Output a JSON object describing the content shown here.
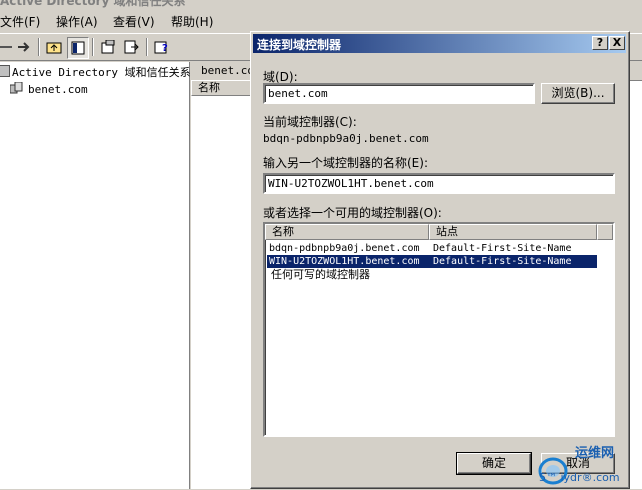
{
  "window": {
    "title": "Active Directory 域和信任关系"
  },
  "menu": [
    {
      "label": "文件(F)"
    },
    {
      "label": "操作(A)"
    },
    {
      "label": "查看(V)"
    },
    {
      "label": "帮助(H)"
    }
  ],
  "toolbar": {
    "icons": [
      "back-arrow-icon",
      "forward-arrow-icon",
      "up-folder-icon",
      "show-tree-icon",
      "properties-icon",
      "export-list-icon",
      "help-icon"
    ]
  },
  "tree": {
    "root": "Active Directory 域和信任关系",
    "child": "benet.com"
  },
  "right_pane": {
    "header": "benet.co",
    "column": "名称"
  },
  "dialog": {
    "title": "连接到域控制器",
    "help_btn": "?",
    "close_btn": "X",
    "domain_label": "域(D):",
    "domain_value": "benet.com",
    "browse_label": "浏览(B)...",
    "current_dc_label": "当前域控制器(C):",
    "current_dc_value": "bdqn-pdbnpb9a0j.benet.com",
    "other_dc_label": "输入另一个域控制器的名称(E):",
    "other_dc_value": "WIN-U2TOZWOL1HT.benet.com",
    "choose_label": "或者选择一个可用的域控制器(O):",
    "list_headers": [
      "名称",
      "站点"
    ],
    "list_rows": [
      {
        "name": "bdqn-pdbnpb9a0j.benet.com",
        "site": "Default-First-Site-Name",
        "selected": false
      },
      {
        "name": "WIN-U2TOZWOL1HT.benet.com",
        "site": "Default-First-Site-Name",
        "selected": true
      },
      {
        "name": "任何可写的域控制器",
        "site": "",
        "selected": false
      }
    ],
    "ok_label": "确定",
    "cancel_label": "取消"
  },
  "watermark": {
    "text": "运维网",
    "sub": "5™ iydr®.com"
  }
}
